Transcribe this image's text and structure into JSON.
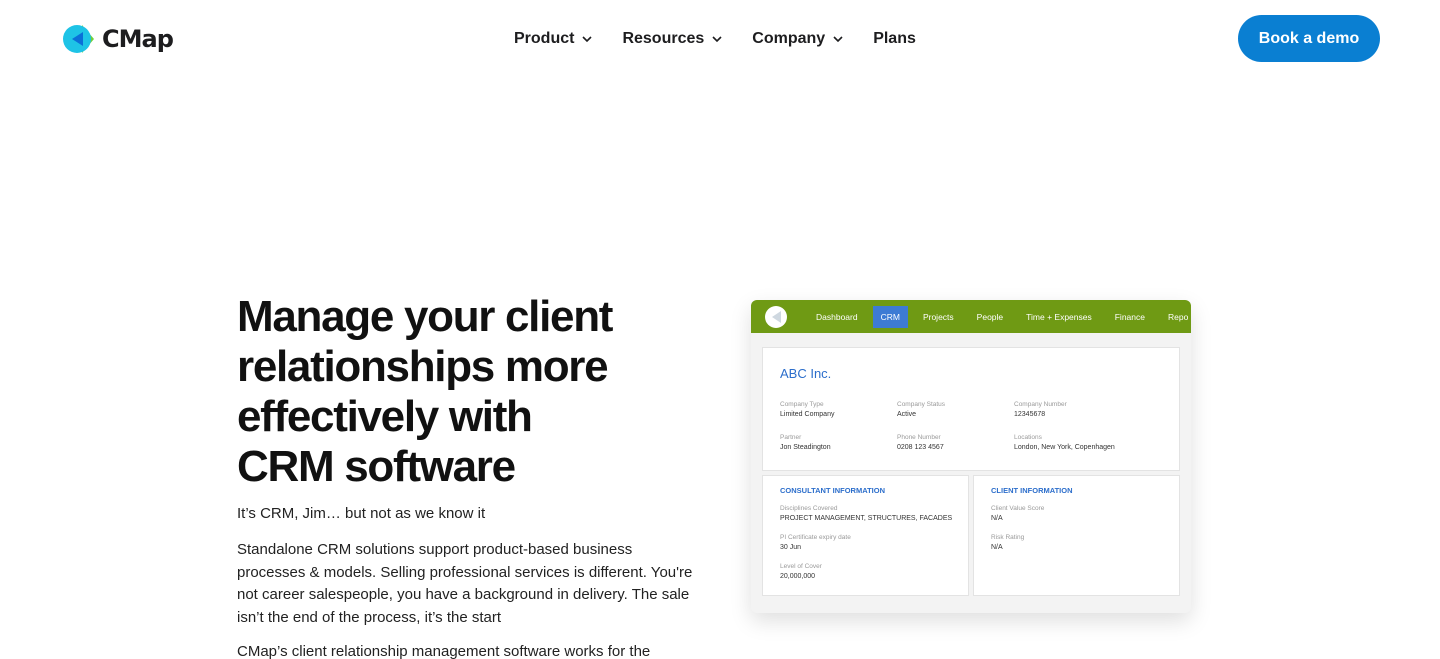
{
  "brand": {
    "name": "CMap"
  },
  "nav": {
    "items": [
      {
        "label": "Product",
        "icon": "chevron-down-icon"
      },
      {
        "label": "Resources",
        "icon": "chevron-down-icon"
      },
      {
        "label": "Company",
        "icon": "chevron-down-icon"
      },
      {
        "label": "Plans"
      }
    ],
    "cta_label": "Book a demo"
  },
  "hero": {
    "title_lines": [
      "Manage your client",
      "relationships more",
      "effectively with",
      "CRM software"
    ],
    "tagline": "It’s CRM, Jim… but not as we know it",
    "paragraph_lines": [
      "Standalone CRM solutions support product-based business",
      "processes & models. Selling professional services is different. You're",
      "not career salespeople, you have a background in delivery. The sale",
      "isn’t the end of the process, it’s the start"
    ],
    "paragraph2": "CMap’s client relationship management software works for the"
  },
  "mockup": {
    "tabs": [
      "Dashboard",
      "CRM",
      "Projects",
      "People",
      "Time + Expenses",
      "Finance",
      "Repo"
    ],
    "active_tab": "CRM",
    "company": {
      "name": "ABC Inc.",
      "fields": [
        {
          "label": "Company Type",
          "value": "Limited Company"
        },
        {
          "label": "Company Status",
          "value": "Active"
        },
        {
          "label": "Company Number",
          "value": "12345678"
        },
        {
          "label": "Partner",
          "value": "Jon Steadington"
        },
        {
          "label": "Phone Number",
          "value": "0208 123 4567"
        },
        {
          "label": "Locations",
          "value": "London, New York, Copenhagen"
        }
      ]
    },
    "consultant": {
      "title": "CONSULTANT INFORMATION",
      "fields": [
        {
          "label": "Disciplines Covered",
          "value": "PROJECT MANAGEMENT, STRUCTURES, FACADES"
        },
        {
          "label": "PI Certificate expiry date",
          "value": "30 Jun"
        },
        {
          "label": "Level of Cover",
          "value": "20,000,000"
        }
      ]
    },
    "client": {
      "title": "CLIENT INFORMATION",
      "fields": [
        {
          "label": "Client Value Score",
          "value": "N/A"
        },
        {
          "label": "Risk Rating",
          "value": "N/A"
        }
      ]
    }
  },
  "colors": {
    "primary": "#0a7fd2",
    "app_bar": "#6f9a14",
    "accent_link": "#2c6ecb",
    "logo_cyan": "#1ec3e6",
    "logo_blue": "#0a6fd8",
    "logo_green": "#6fd13a"
  }
}
